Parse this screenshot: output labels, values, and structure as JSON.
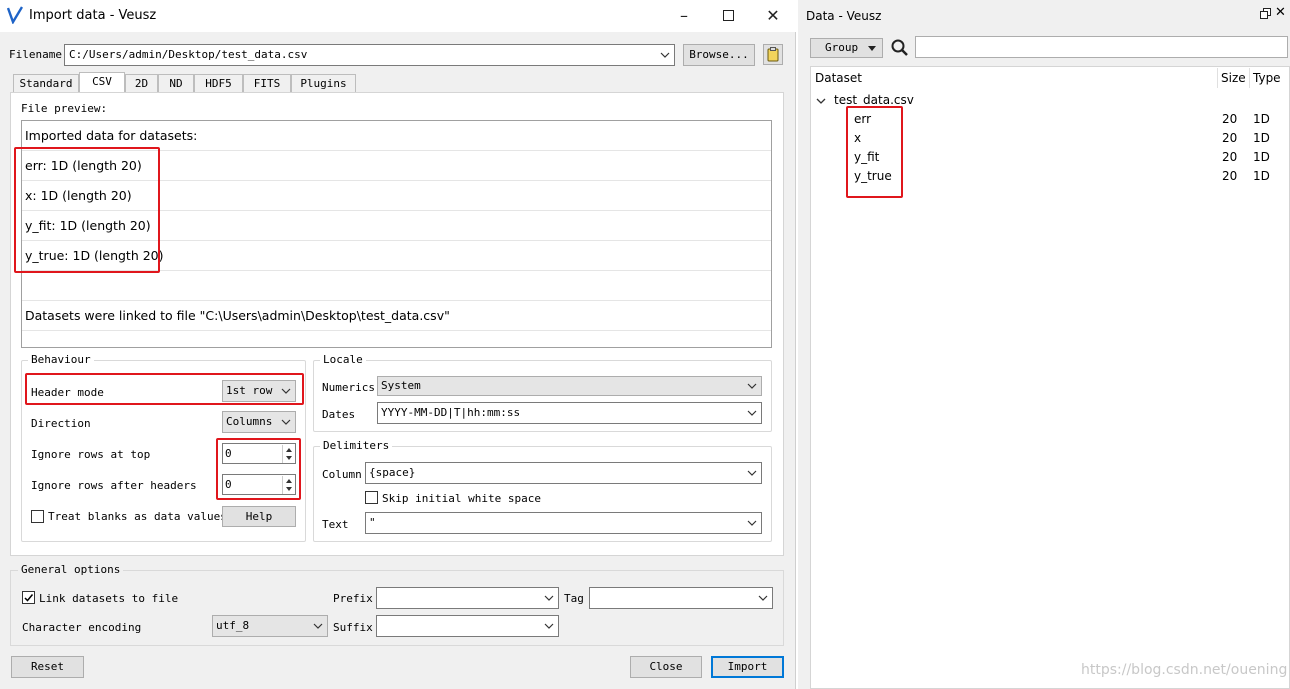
{
  "dialog": {
    "title": "Import data - Veusz",
    "filename_label": "Filename",
    "filename_value": "C:/Users/admin/Desktop/test_data.csv",
    "browse_label": "Browse...",
    "tabs": [
      "Standard",
      "CSV",
      "2D",
      "ND",
      "HDF5",
      "FITS",
      "Plugins"
    ],
    "file_preview_label": "File preview:",
    "preview_lines": [
      "Imported data for datasets:",
      "err: 1D (length 20)",
      "x: 1D (length 20)",
      "y_fit: 1D (length 20)",
      "y_true: 1D (length 20)",
      "",
      "Datasets were linked to file \"C:\\Users\\admin\\Desktop\\test_data.csv\""
    ],
    "behaviour": {
      "title": "Behaviour",
      "header_mode_label": "Header mode",
      "header_mode_value": "1st row",
      "direction_label": "Direction",
      "direction_value": "Columns",
      "ignore_top_label": "Ignore rows at top",
      "ignore_top_value": "0",
      "ignore_after_label": "Ignore rows after headers",
      "ignore_after_value": "0",
      "treat_blanks_label": "Treat blanks as data values",
      "help_label": "Help"
    },
    "locale": {
      "title": "Locale",
      "numerics_label": "Numerics",
      "numerics_value": "System",
      "dates_label": "Dates",
      "dates_value": "YYYY-MM-DD|T|hh:mm:ss"
    },
    "delimiters": {
      "title": "Delimiters",
      "column_label": "Column",
      "column_value": "{space}",
      "skip_ws_label": "Skip initial white space",
      "text_label": "Text",
      "text_value": "\""
    },
    "general": {
      "title": "General options",
      "link_label": "Link datasets to file",
      "prefix_label": "Prefix",
      "tag_label": "Tag",
      "encoding_label": "Character encoding",
      "encoding_value": "utf_8",
      "suffix_label": "Suffix"
    },
    "reset_label": "Reset",
    "close_label": "Close",
    "import_label": "Import"
  },
  "data_panel": {
    "title": "Data - Veusz",
    "group_label": "Group",
    "columns": [
      "Dataset",
      "Size",
      "Type"
    ],
    "file_node": "test_data.csv",
    "rows": [
      {
        "name": "err",
        "size": "20",
        "type": "1D"
      },
      {
        "name": "x",
        "size": "20",
        "type": "1D"
      },
      {
        "name": "y_fit",
        "size": "20",
        "type": "1D"
      },
      {
        "name": "y_true",
        "size": "20",
        "type": "1D"
      }
    ],
    "watermark": "https://blog.csdn.net/ouening"
  },
  "colors": {
    "highlight_red": "#e0161c",
    "veusz_logo": "#1e63c7"
  }
}
